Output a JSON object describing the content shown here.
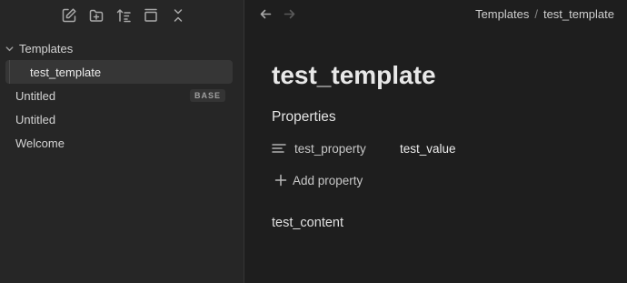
{
  "sidebar": {
    "toolbar": [
      {
        "icon": "new-note-icon"
      },
      {
        "icon": "new-folder-icon"
      },
      {
        "icon": "sort-icon"
      },
      {
        "icon": "collapse-panel-icon"
      },
      {
        "icon": "collapse-all-icon"
      }
    ],
    "folder": {
      "label": "Templates",
      "children": [
        {
          "label": "test_template",
          "active": true
        }
      ]
    },
    "files": [
      {
        "label": "Untitled",
        "badge": "BASE"
      },
      {
        "label": "Untitled",
        "badge": ""
      },
      {
        "label": "Welcome",
        "badge": ""
      }
    ]
  },
  "topbar": {
    "breadcrumb": [
      "Templates",
      "test_template"
    ],
    "separator": "/"
  },
  "note": {
    "title": "test_template",
    "properties_heading": "Properties",
    "properties": [
      {
        "key": "test_property",
        "value": "test_value",
        "icon": "text-lines-icon"
      }
    ],
    "add_property_label": "Add property",
    "body": "test_content"
  },
  "colors": {
    "sidebar_bg": "#262626",
    "main_bg": "#1e1e1e",
    "active_item_bg": "#363636"
  }
}
